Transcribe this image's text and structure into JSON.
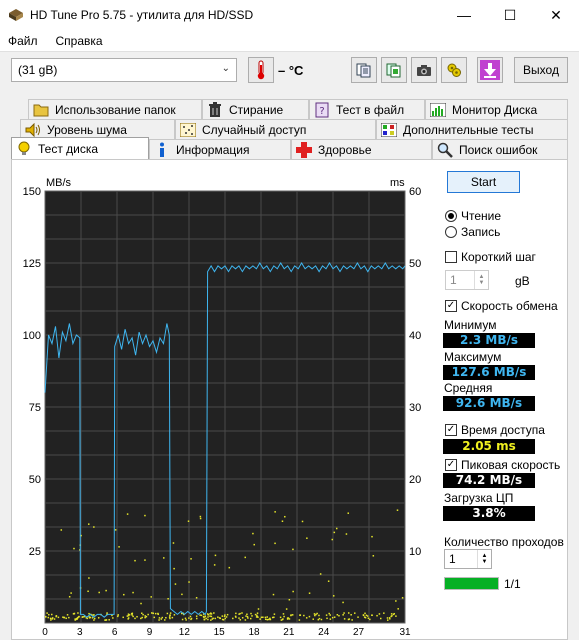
{
  "window": {
    "title": "HD Tune Pro 5.75 - утилита для HD/SSD",
    "minimize": "—",
    "maximize": "☐",
    "close": "✕"
  },
  "menu": {
    "file": "Файл",
    "help": "Справка"
  },
  "toolbar": {
    "drive": "(31 gB)",
    "temperature": "– °C",
    "exit_label": "Выход"
  },
  "tabs": {
    "row1": [
      "Использование папок",
      "Стирание",
      "Тест в файл",
      "Монитор Диска"
    ],
    "row2": [
      "Уровень шума",
      "Случайный доступ",
      "Дополнительные  тесты"
    ],
    "row3": [
      "Тест диска",
      "Информация",
      "Здоровье",
      "Поиск ошибок"
    ],
    "active": "Тест диска"
  },
  "side": {
    "start_label": "Start",
    "read_label": "Чтение",
    "write_label": "Запись",
    "mode_selected": "read",
    "short_step_label": "Короткий шаг",
    "short_step_checked": false,
    "short_step_value": "1",
    "short_step_unit": "gB",
    "transfer_rate_label": "Скорость обмена",
    "transfer_rate_checked": true,
    "min_label": "Минимум",
    "min_value": "2.3 MB/s",
    "max_label": "Максимум",
    "max_value": "127.6 MB/s",
    "avg_label": "Средняя",
    "avg_value": "92.6 MB/s",
    "access_time_label": "Время доступа",
    "access_time_checked": true,
    "access_time_value": "2.05 ms",
    "burst_label": "Пиковая скорость",
    "burst_checked": true,
    "burst_value": "74.2 MB/s",
    "cpu_label": "Загрузка ЦП",
    "cpu_value": "3.8%",
    "passes_label": "Количество проходов",
    "passes_value": "1",
    "progress_text": "1/1",
    "progress_fraction": 1.0
  },
  "colors": {
    "cyan": "#3fb6f0",
    "yellow": "#e6e62a",
    "white_val": "#ffffff"
  },
  "chart_data": {
    "type": "line",
    "left_unit": "MB/s",
    "right_unit": "ms",
    "y_ticks_left": [
      "150",
      "125",
      "100",
      "75",
      "50",
      "25"
    ],
    "y_ticks_right": [
      "60",
      "50",
      "40",
      "30",
      "20",
      "10"
    ],
    "ylim_left": [
      0,
      150
    ],
    "ylim_right": [
      0,
      60
    ],
    "xlim": [
      0,
      31
    ],
    "x_ticks": [
      "0",
      "3",
      "6",
      "9",
      "12",
      "15",
      "18",
      "21",
      "24",
      "27",
      "31"
    ],
    "x_unit": "gB",
    "series": [
      {
        "values": [
          [
            0,
            80
          ],
          [
            0.3,
            100
          ],
          [
            0.6,
            97
          ],
          [
            0.9,
            103
          ],
          [
            1.2,
            92
          ],
          [
            1.5,
            101
          ],
          [
            1.8,
            98
          ],
          [
            2.1,
            104
          ],
          [
            2.4,
            97
          ],
          [
            2.7,
            100
          ],
          [
            3.0,
            99
          ],
          [
            3.05,
            3
          ],
          [
            3.3,
            3
          ],
          [
            3.6,
            2
          ],
          [
            3.9,
            3
          ],
          [
            4.2,
            2
          ],
          [
            4.5,
            3
          ],
          [
            4.8,
            3
          ],
          [
            5.1,
            2
          ],
          [
            5.4,
            3
          ],
          [
            5.7,
            3
          ],
          [
            5.95,
            3
          ],
          [
            6.0,
            96
          ],
          [
            6.3,
            100
          ],
          [
            6.6,
            95
          ],
          [
            6.9,
            102
          ],
          [
            7.2,
            97
          ],
          [
            7.5,
            99
          ],
          [
            7.8,
            93
          ],
          [
            8.1,
            101
          ],
          [
            8.4,
            97
          ],
          [
            8.7,
            100
          ],
          [
            9.0,
            96
          ],
          [
            9.3,
            98
          ],
          [
            9.6,
            94
          ],
          [
            9.9,
            99
          ],
          [
            10.2,
            97
          ],
          [
            10.5,
            104
          ],
          [
            10.7,
            100
          ],
          [
            10.8,
            5
          ],
          [
            11.1,
            4
          ],
          [
            11.4,
            3
          ],
          [
            11.7,
            4
          ],
          [
            12.0,
            3
          ],
          [
            12.3,
            4
          ],
          [
            12.6,
            3
          ],
          [
            12.9,
            4
          ],
          [
            13.2,
            3
          ],
          [
            13.5,
            4
          ],
          [
            13.8,
            3
          ],
          [
            13.9,
            4
          ],
          [
            14.0,
            122
          ],
          [
            14.3,
            124
          ],
          [
            14.6,
            122
          ],
          [
            14.9,
            124
          ],
          [
            15.2,
            123
          ],
          [
            15.5,
            124
          ],
          [
            15.8,
            122
          ],
          [
            16.1,
            124
          ],
          [
            16.4,
            123
          ],
          [
            16.7,
            124
          ],
          [
            17.0,
            122
          ],
          [
            17.3,
            124
          ],
          [
            17.6,
            123
          ],
          [
            17.9,
            124
          ],
          [
            18.2,
            123
          ],
          [
            18.5,
            125
          ],
          [
            18.8,
            123
          ],
          [
            19.1,
            124
          ],
          [
            19.4,
            122
          ],
          [
            19.7,
            124
          ],
          [
            20.0,
            123
          ],
          [
            20.3,
            125
          ],
          [
            20.6,
            123
          ],
          [
            20.9,
            124
          ],
          [
            21.2,
            122
          ],
          [
            21.5,
            124
          ],
          [
            21.8,
            123
          ],
          [
            22.1,
            125
          ],
          [
            22.4,
            123
          ],
          [
            22.7,
            124
          ],
          [
            23.0,
            123
          ],
          [
            23.3,
            124
          ],
          [
            23.6,
            122
          ],
          [
            23.9,
            124
          ],
          [
            24.2,
            123
          ],
          [
            24.5,
            125
          ],
          [
            24.8,
            123
          ],
          [
            25.1,
            124
          ],
          [
            25.4,
            122
          ],
          [
            25.7,
            124
          ],
          [
            26.0,
            123
          ],
          [
            26.3,
            124
          ],
          [
            26.6,
            123
          ],
          [
            26.9,
            125
          ],
          [
            27.2,
            123
          ],
          [
            27.5,
            124
          ],
          [
            27.8,
            122
          ],
          [
            28.1,
            124
          ],
          [
            28.4,
            123
          ],
          [
            28.7,
            124
          ],
          [
            29.0,
            123
          ],
          [
            29.3,
            125
          ],
          [
            29.6,
            123
          ],
          [
            29.9,
            124
          ],
          [
            30.2,
            123
          ],
          [
            30.5,
            124
          ],
          [
            30.8,
            123
          ],
          [
            31.0,
            124
          ]
        ]
      }
    ],
    "access_time_band_ms": [
      0.5,
      1.5
    ],
    "grid": true
  }
}
